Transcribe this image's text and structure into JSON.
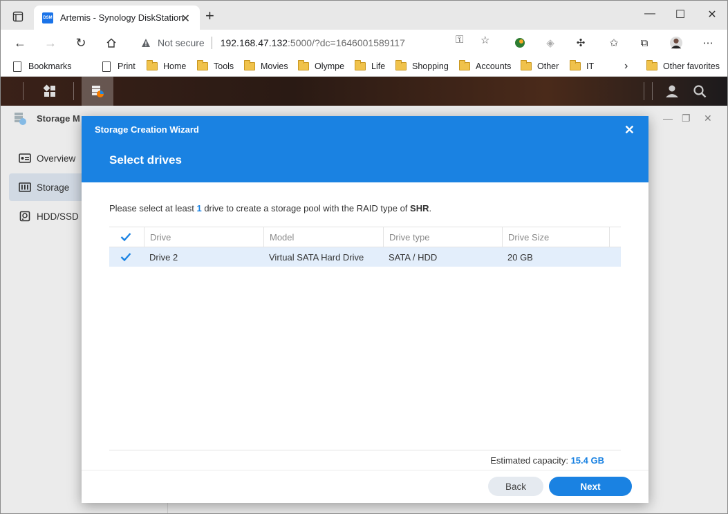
{
  "browser": {
    "tab_title": "Artemis - Synology DiskStation",
    "favicon_text": "DSM",
    "security_label": "Not secure",
    "url_host": "192.168.47.132",
    "url_rest": ":5000/?dc=1646001589117",
    "bookmarks": [
      {
        "label": "Bookmarks",
        "icon": "page-icon"
      },
      {
        "label": "Print",
        "icon": "page-icon"
      },
      {
        "label": "Home",
        "icon": "folder-icon"
      },
      {
        "label": "Tools",
        "icon": "folder-icon"
      },
      {
        "label": "Movies",
        "icon": "folder-icon"
      },
      {
        "label": "Olympe",
        "icon": "folder-icon"
      },
      {
        "label": "Life",
        "icon": "folder-icon"
      },
      {
        "label": "Shopping",
        "icon": "folder-icon"
      },
      {
        "label": "Accounts",
        "icon": "folder-icon"
      },
      {
        "label": "Other",
        "icon": "folder-icon"
      },
      {
        "label": "IT",
        "icon": "folder-icon"
      }
    ],
    "other_favorites": "Other favorites"
  },
  "app": {
    "title": "Storage M",
    "sidebar": [
      {
        "label": "Overview",
        "active": false
      },
      {
        "label": "Storage",
        "active": true
      },
      {
        "label": "HDD/SSD",
        "active": false
      }
    ]
  },
  "wizard": {
    "title": "Storage Creation Wizard",
    "step_title": "Select drives",
    "desc_pre": "Please select at least ",
    "desc_count": "1",
    "desc_mid": " drive to create a storage pool with the RAID type of ",
    "desc_raid": "SHR",
    "desc_post": ".",
    "columns": [
      "Drive",
      "Model",
      "Drive type",
      "Drive Size"
    ],
    "rows": [
      {
        "drive": "Drive 2",
        "model": "Virtual SATA Hard Drive",
        "type": "SATA / HDD",
        "size": "20 GB",
        "checked": true
      }
    ],
    "estimated_label": "Estimated capacity: ",
    "estimated_value": "15.4 GB",
    "back_label": "Back",
    "next_label": "Next"
  },
  "colors": {
    "accent": "#1a82e2",
    "row_selected": "#e3eefb",
    "sidebar_active": "#e3ecf7"
  }
}
